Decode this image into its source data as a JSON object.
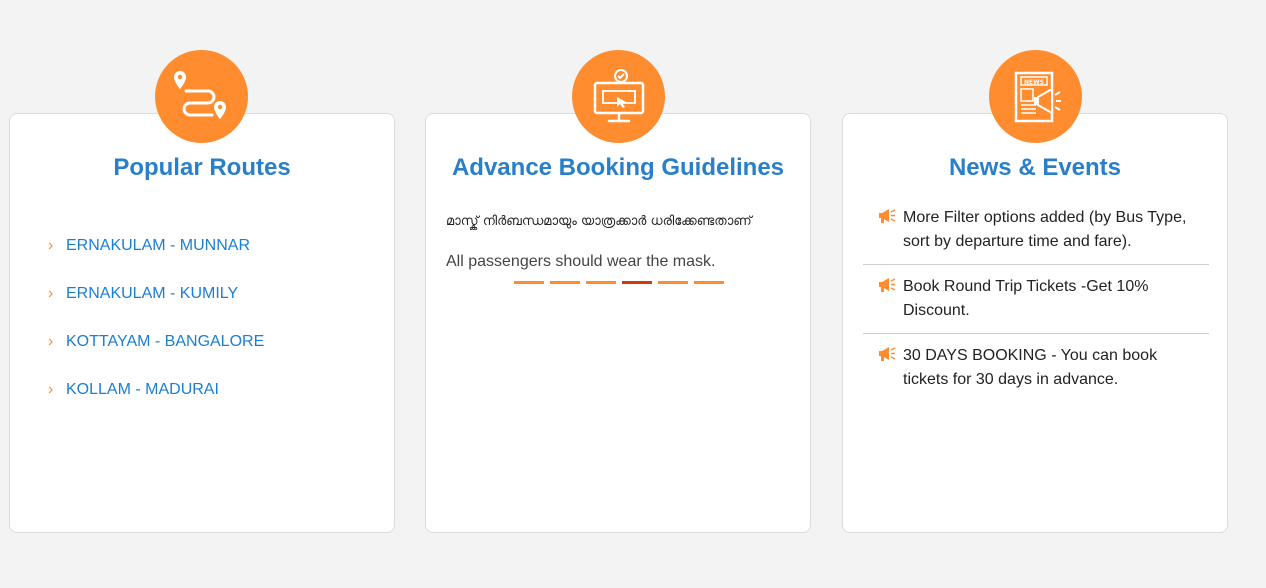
{
  "colors": {
    "accent": "#ff8c2e",
    "title": "#2a7fc9",
    "link": "#1a7fd1",
    "active_dot": "#d03a12"
  },
  "popular_routes": {
    "title": "Popular Routes",
    "icon": "route-map-icon",
    "items": [
      {
        "label": "ERNAKULAM - MUNNAR"
      },
      {
        "label": "ERNAKULAM - KUMILY"
      },
      {
        "label": "KOTTAYAM - BANGALORE"
      },
      {
        "label": "KOLLAM - MADURAI"
      }
    ]
  },
  "guidelines": {
    "title": "Advance Booking Guidelines",
    "icon": "monitor-booking-icon",
    "malayalam_text": "മാസ്ക് നിർബന്ധമായും യാത്രക്കാർ ധരിക്കേണ്ടതാണ്",
    "english_text": "All passengers should wear the mask.",
    "slides_total": 6,
    "active_slide": 4
  },
  "news": {
    "title": "News & Events",
    "icon": "newspaper-megaphone-icon",
    "items": [
      {
        "text": "More Filter options added (by Bus Type, sort by departure time and fare)."
      },
      {
        "text": "Book Round Trip Tickets -Get 10% Discount."
      },
      {
        "text": "30 DAYS BOOKING - You can book tickets for 30 days in advance."
      }
    ]
  }
}
